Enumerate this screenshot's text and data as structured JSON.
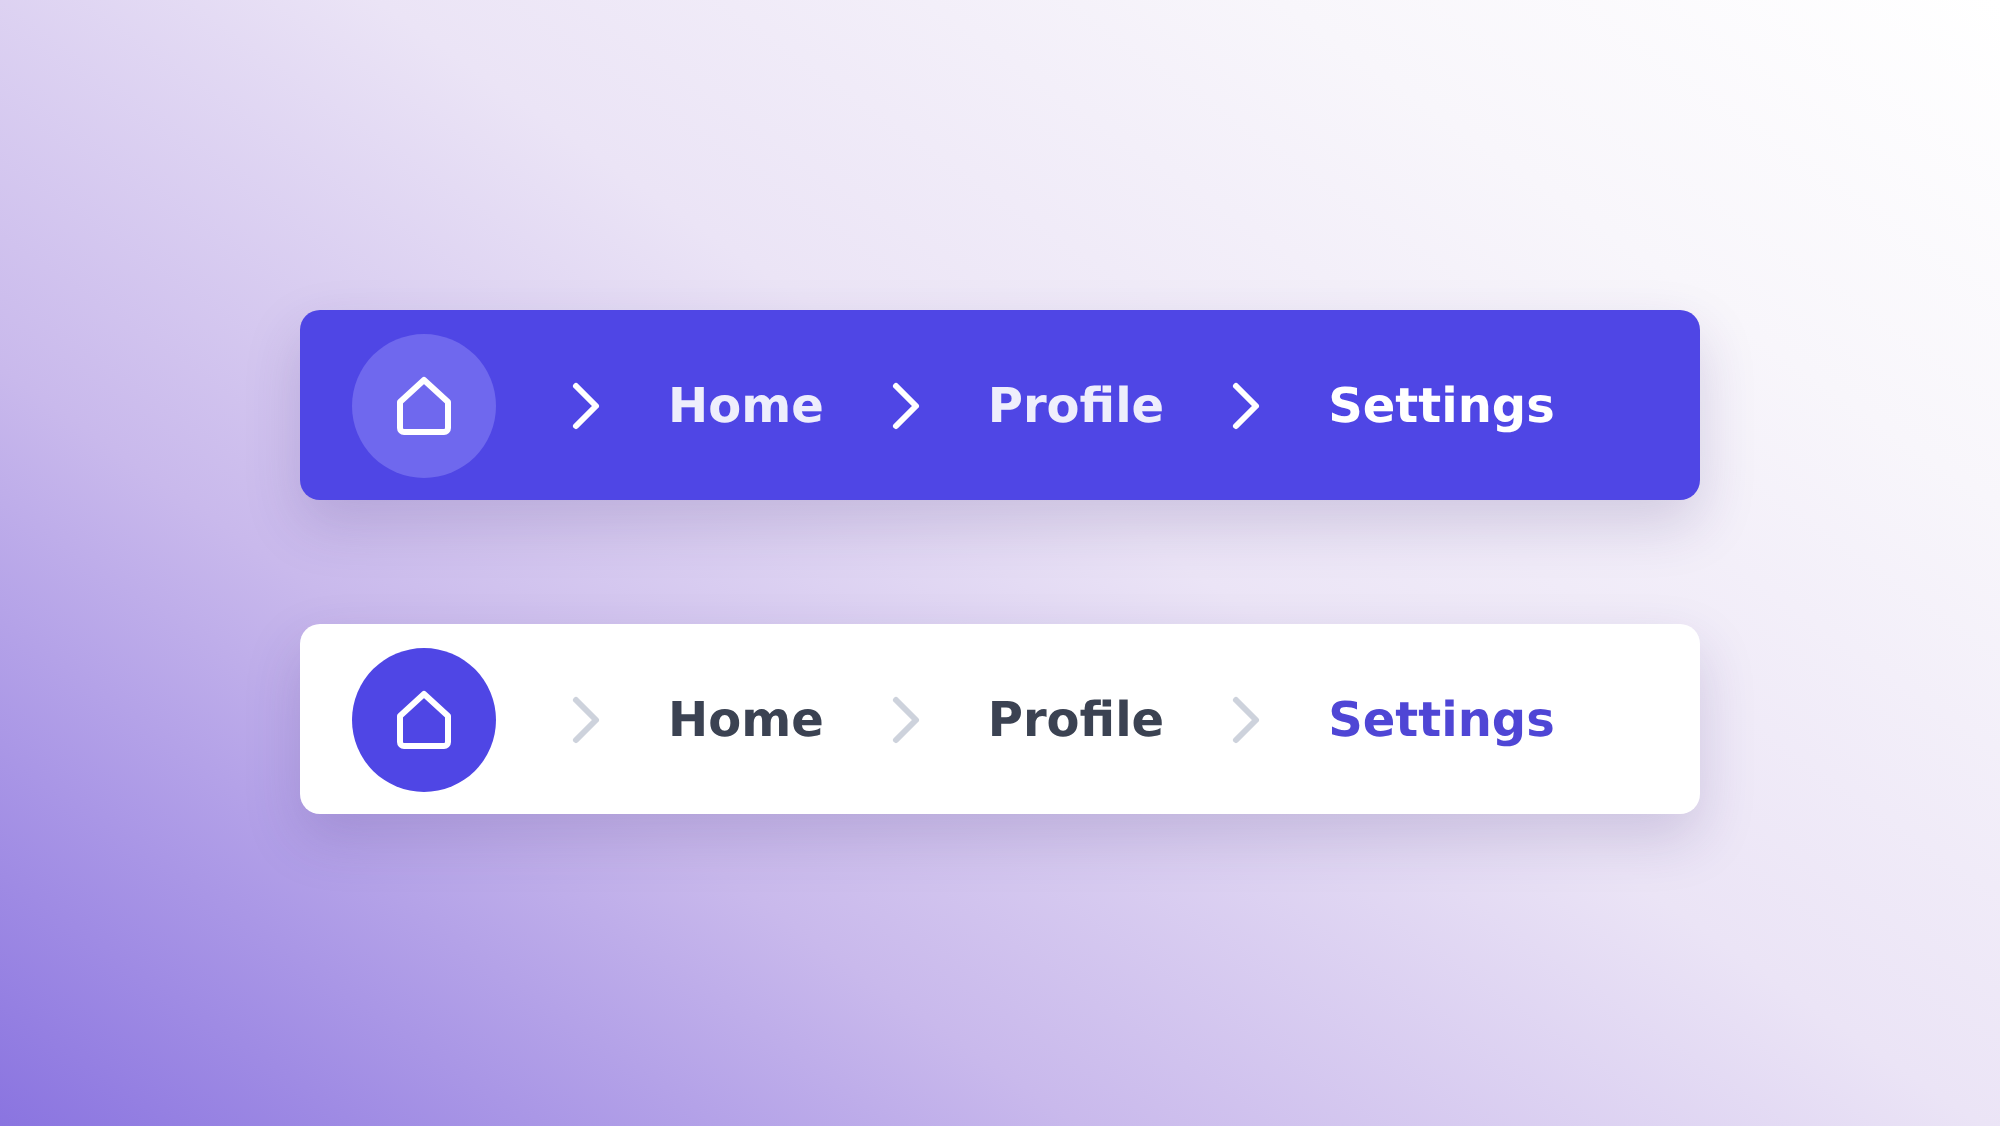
{
  "breadcrumbs": [
    {
      "kind": "dark",
      "items": [
        {
          "label": "Home",
          "selected": false
        },
        {
          "label": "Profile",
          "selected": false
        },
        {
          "label": "Settings",
          "selected": true
        }
      ]
    },
    {
      "kind": "light",
      "items": [
        {
          "label": "Home",
          "selected": false
        },
        {
          "label": "Profile",
          "selected": false
        },
        {
          "label": "Settings",
          "selected": true
        }
      ]
    }
  ]
}
